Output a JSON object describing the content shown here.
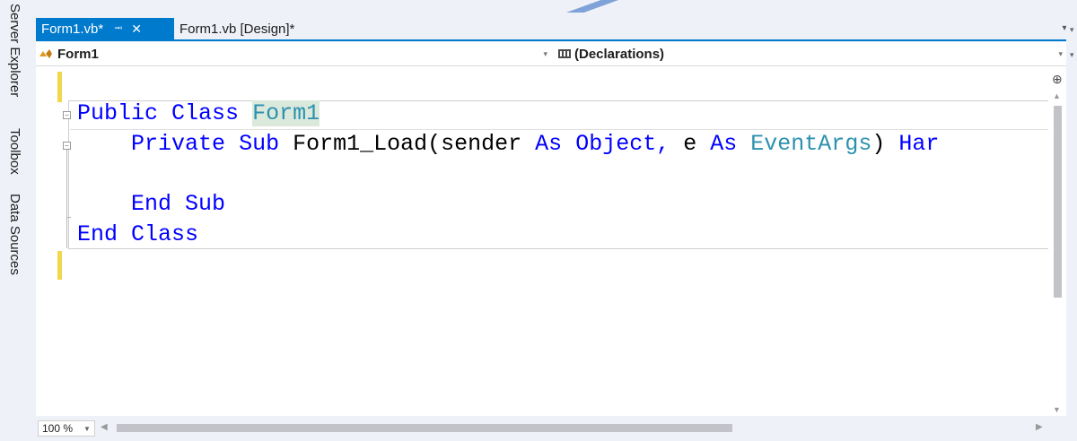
{
  "side_panel": {
    "items": [
      {
        "label": "Server Explorer"
      },
      {
        "label": "Toolbox"
      },
      {
        "label": "Data Sources"
      }
    ]
  },
  "tabs": [
    {
      "label": "Form1.vb*",
      "active": true
    },
    {
      "label": "Form1.vb [Design]*",
      "active": false
    }
  ],
  "navbar": {
    "left_value": "Form1",
    "right_value": "(Declarations)"
  },
  "code": {
    "line1": {
      "k1": "Public",
      "k2": "Class",
      "name": "Form1"
    },
    "line2": {
      "k1": "Private",
      "k2": "Sub",
      "t1": "Form1_Load(sender",
      "k3": "As",
      "k4": "Object,",
      "t2": "e",
      "k5": "As",
      "typ": "EventArgs",
      "t3": ")",
      "trail": "Har"
    },
    "line3": {
      "k1": "End",
      "k2": "Sub"
    },
    "line4": {
      "k1": "End",
      "k2": "Class"
    }
  },
  "status": {
    "zoom": "100 %"
  },
  "colors": {
    "accent": "#007acc",
    "keyword": "#0000ff",
    "type": "#2b91af",
    "change_marker": "#f2d64b"
  }
}
